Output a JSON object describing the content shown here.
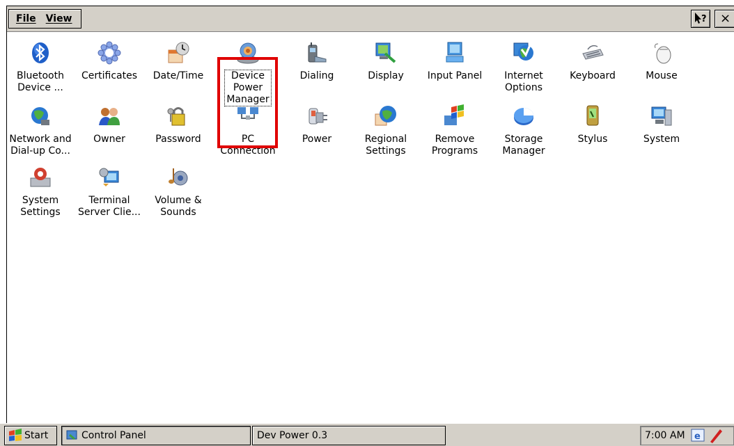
{
  "menu": {
    "file": {
      "hotkey": "F",
      "rest": "ile"
    },
    "view": {
      "hotkey": "V",
      "rest": "iew"
    }
  },
  "title_buttons": {
    "help_icon": "help-question-icon",
    "close_glyph": "×"
  },
  "items": [
    {
      "label": "Bluetooth\nDevice ...",
      "icon": "bluetooth-icon"
    },
    {
      "label": "Certificates",
      "icon": "certificates-icon"
    },
    {
      "label": "Date/Time",
      "icon": "calendar-clock-icon"
    },
    {
      "label": "Device\nPower\nManager",
      "icon": "device-power-manager-icon"
    },
    {
      "label": "Dialing",
      "icon": "dialing-phone-icon"
    },
    {
      "label": "Display",
      "icon": "display-monitor-icon"
    },
    {
      "label": "Input Panel",
      "icon": "input-panel-keyboard-icon"
    },
    {
      "label": "Internet\nOptions",
      "icon": "internet-options-globe-icon"
    },
    {
      "label": "Keyboard",
      "icon": "keyboard-icon"
    },
    {
      "label": "Mouse",
      "icon": "mouse-icon"
    },
    {
      "label": "Network and\nDial-up Co...",
      "icon": "network-globe-icon"
    },
    {
      "label": "Owner",
      "icon": "owner-users-icon"
    },
    {
      "label": "Password",
      "icon": "password-keys-icon"
    },
    {
      "label": "PC\nConnection",
      "icon": "pc-connection-icon"
    },
    {
      "label": "Power",
      "icon": "power-plug-icon"
    },
    {
      "label": "Regional\nSettings",
      "icon": "regional-settings-globe-icon"
    },
    {
      "label": "Remove\nPrograms",
      "icon": "remove-programs-icon"
    },
    {
      "label": "Storage\nManager",
      "icon": "storage-manager-pie-icon"
    },
    {
      "label": "Stylus",
      "icon": "stylus-pda-icon"
    },
    {
      "label": "System",
      "icon": "system-computer-icon"
    },
    {
      "label": "System\nSettings",
      "icon": "system-settings-drive-icon"
    },
    {
      "label": "Terminal\nServer Clie...",
      "icon": "terminal-server-icon"
    },
    {
      "label": "Volume &\nSounds",
      "icon": "volume-sounds-music-icon"
    }
  ],
  "taskbar": {
    "start_label": "Start",
    "control_panel_label": "Control Panel",
    "dev_power_label": "Dev Power 0.3",
    "clock": "7:00 AM"
  },
  "colors": {
    "highlight": "#e00000",
    "chrome": "#d4d0c8"
  }
}
